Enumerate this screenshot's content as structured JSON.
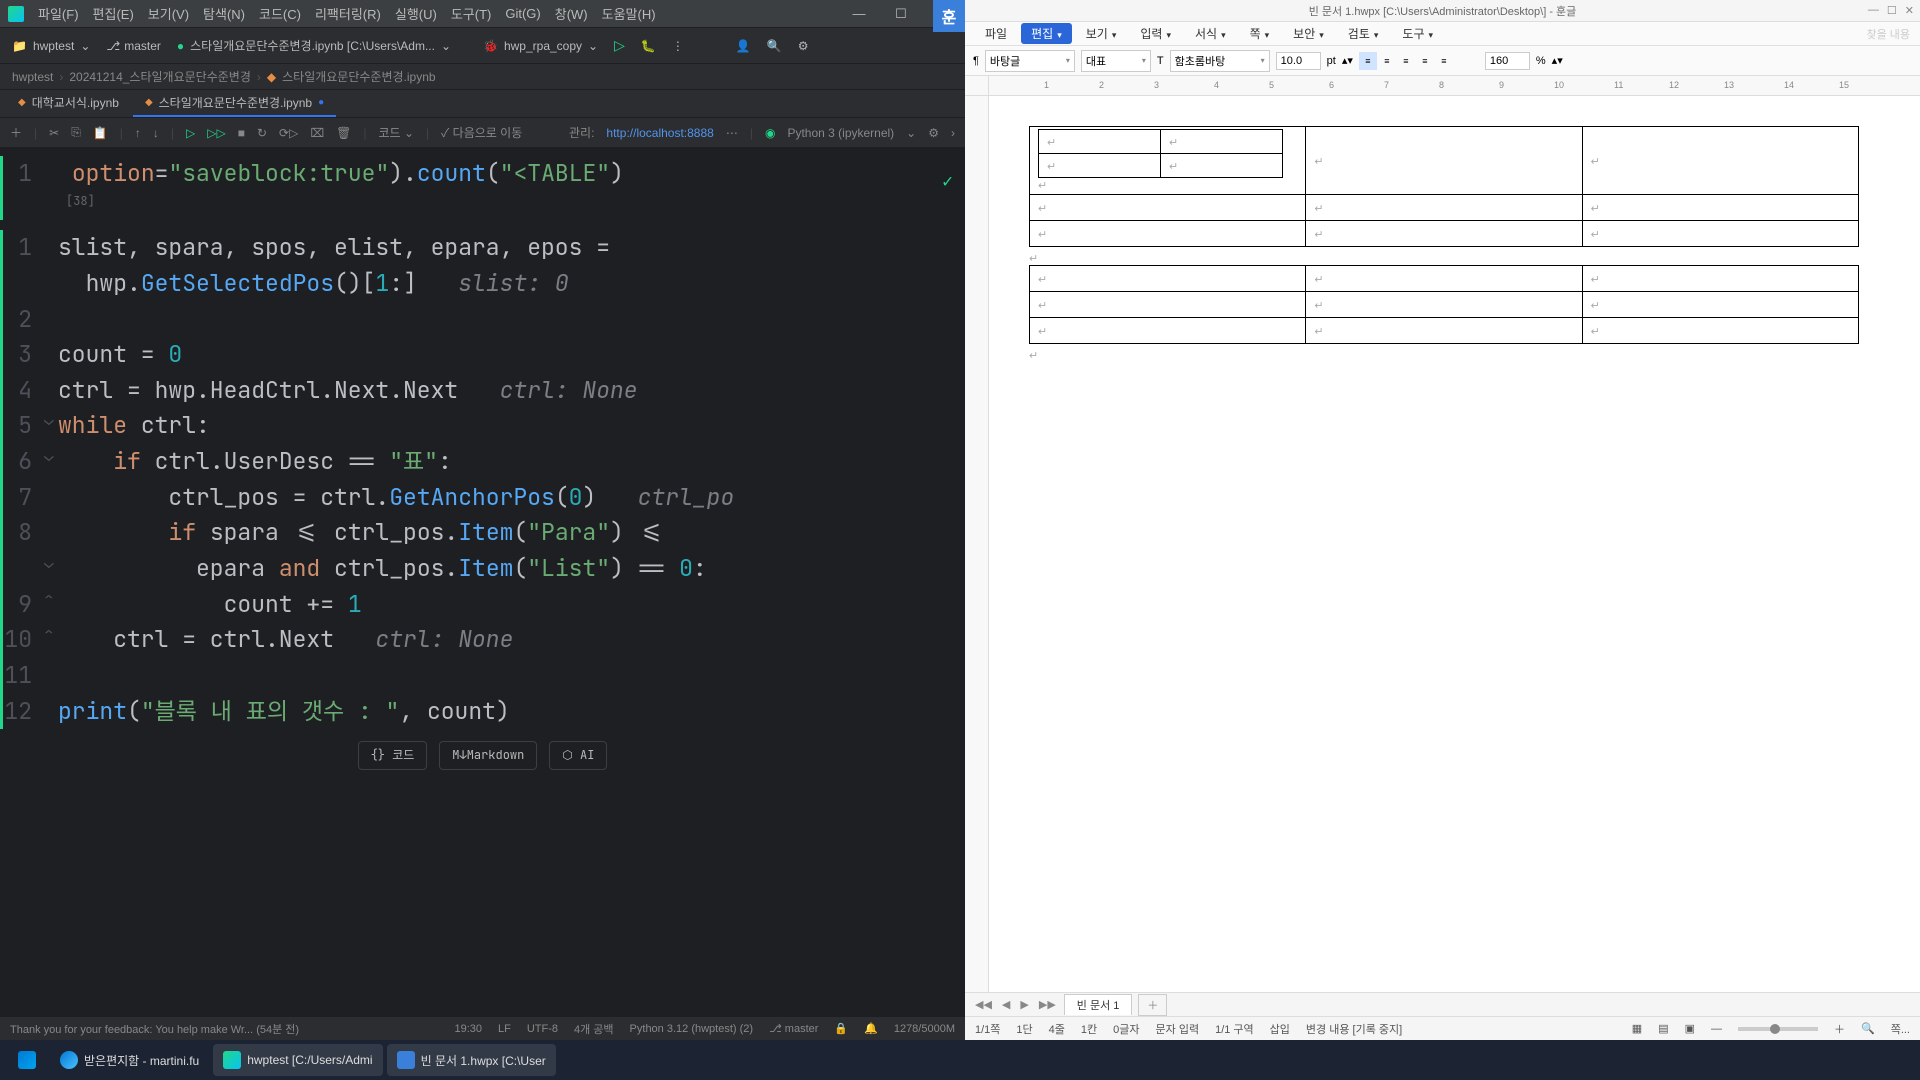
{
  "pycharm": {
    "menu": [
      "파일(F)",
      "편집(E)",
      "보기(V)",
      "탐색(N)",
      "코드(C)",
      "리팩터링(R)",
      "실행(U)",
      "도구(T)",
      "Git(G)",
      "창(W)",
      "도움말(H)"
    ],
    "project": "hwptest",
    "branch": "master",
    "run_configs": [
      {
        "label": "스타일개요문단수준변경.ipynb [C:\\Users\\Adm...",
        "path_hint": true
      },
      {
        "label": "hwp_rpa_copy"
      }
    ],
    "breadcrumb": [
      "hwptest",
      "20241214_스타일개요문단수준변경",
      "스타일개요문단수준변경.ipynb"
    ],
    "tabs": [
      {
        "label": "대학교서식.ipynb",
        "active": false
      },
      {
        "label": "스타일개요문단수준변경.ipynb",
        "active": true,
        "dirty": true
      }
    ],
    "toolbar2": {
      "code_label": "코드",
      "next_label": "다음으로 이동",
      "manage_label": "관리:",
      "manage_url": "http://localhost:8888",
      "kernel": "Python 3 (ipykernel)"
    },
    "code_cell1": {
      "text": "option=\"saveblock:true\").count(\"<TABLE\")",
      "output_label": "[38]"
    },
    "code_lines": [
      {
        "n": "1",
        "text": "slist, spara, spos, elist, epara, epos ="
      },
      {
        "n": "",
        "text": "  hwp.GetSelectedPos()[1:]   slist: 0",
        "hint": "slist: 0"
      },
      {
        "n": "2",
        "text": ""
      },
      {
        "n": "3",
        "text": "count = 0"
      },
      {
        "n": "4",
        "text": "ctrl = hwp.HeadCtrl.Next.Next   ctrl: None",
        "hint": "ctrl: None"
      },
      {
        "n": "5",
        "text": "while ctrl:"
      },
      {
        "n": "6",
        "text": "    if ctrl.UserDesc == \"표\":"
      },
      {
        "n": "7",
        "text": "        ctrl_pos = ctrl.GetAnchorPos(0)   ctrl_po",
        "hint": "ctrl_po"
      },
      {
        "n": "8",
        "text": "        if spara <= ctrl_pos.Item(\"Para\") <="
      },
      {
        "n": "",
        "text": "          epara and ctrl_pos.Item(\"List\") == 0:"
      },
      {
        "n": "9",
        "text": "            count += 1"
      },
      {
        "n": "10",
        "text": "    ctrl = ctrl.Next   ctrl: None",
        "hint": "ctrl: None"
      },
      {
        "n": "11",
        "text": ""
      },
      {
        "n": "12",
        "text": "print(\"블록 내 표의 갯수 : \", count)"
      }
    ],
    "cell_btns": [
      "{} 코드",
      "M↓Markdown",
      "⬡ AI"
    ],
    "status": {
      "left": "Thank you for your feedback: You help make Wr... (54분 전)",
      "pos": "19:30",
      "enc": "LF",
      "charset": "UTF-8",
      "indent": "4개 공백",
      "interp": "Python 3.12 (hwptest) (2)",
      "vcs": "master",
      "mem": "1278/5000M"
    }
  },
  "hwp": {
    "title": "빈 문서 1.hwpx [C:\\Users\\Administrator\\Desktop\\] - 훈글",
    "menu": [
      "파일",
      "편집",
      "보기",
      "입력",
      "서식",
      "쪽",
      "보안",
      "검토",
      "도구"
    ],
    "search_placeholder": "찾을 내용",
    "toolbar": {
      "style": "바탕글",
      "repr": "대표",
      "font": "함초롬바탕",
      "size": "10.0",
      "unit": "pt",
      "zoom": "160",
      "zoom_unit": "%"
    },
    "ruler_ticks": [
      "1",
      "2",
      "3",
      "4",
      "5",
      "6",
      "7",
      "8",
      "9",
      "10",
      "11",
      "12",
      "13",
      "14",
      "15"
    ],
    "doc_tab": "빈 문서 1",
    "status": {
      "page": "1/1쪽",
      "dan": "1단",
      "line": "4줄",
      "col": "1칸",
      "chars": "0글자",
      "mode": "문자 입력",
      "section": "1/1 구역",
      "insert": "삽입",
      "change": "변경 내용 [기록 중지]",
      "zoom_label": "쪽..."
    }
  },
  "taskbar": {
    "items": [
      {
        "icon": "win",
        "label": ""
      },
      {
        "icon": "edge",
        "label": "받은편지함 - martini.fu"
      },
      {
        "icon": "pycharm",
        "label": "hwptest [C:/Users/Admi"
      },
      {
        "icon": "hwp",
        "label": "빈 문서 1.hwpx [C:\\User"
      }
    ]
  }
}
